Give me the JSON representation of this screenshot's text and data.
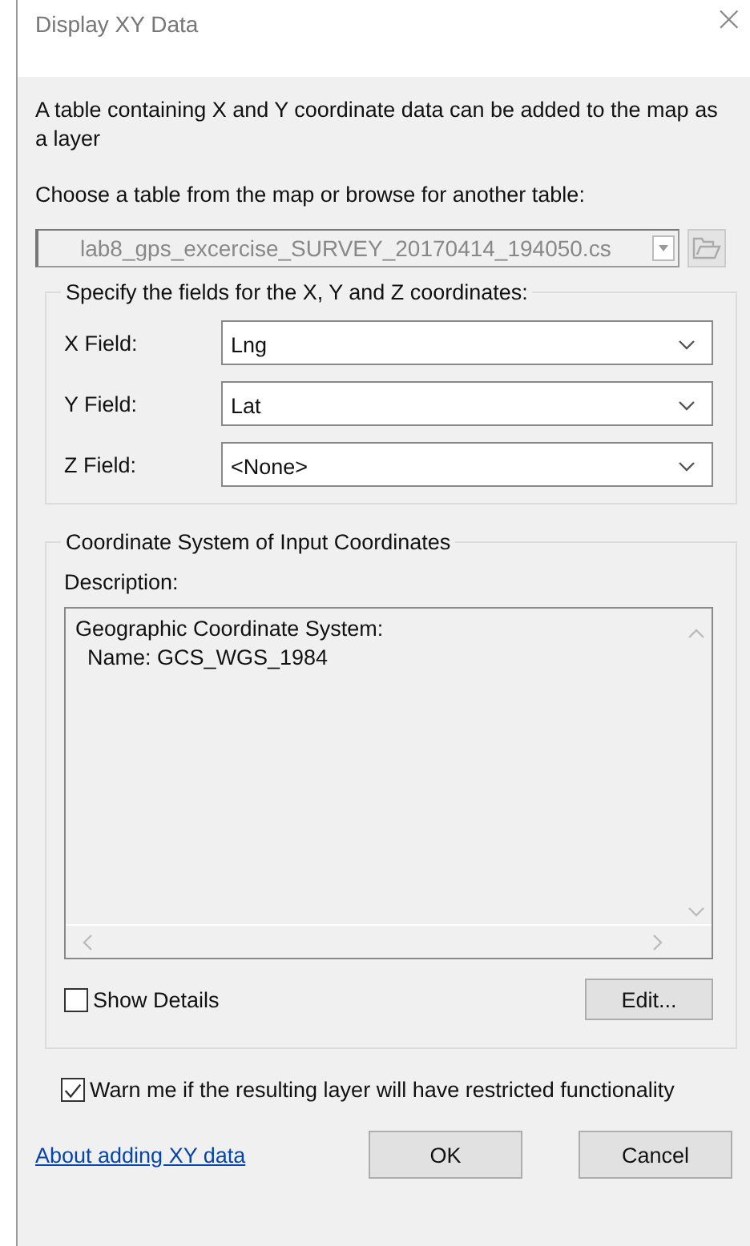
{
  "window": {
    "title": "Display XY Data",
    "close": "×"
  },
  "intro": "A table containing X and Y coordinate data can be added to the map as a layer",
  "table_prompt": "Choose a table from the map or browse for another table:",
  "table_combo": {
    "value": "lab8_gps_excercise_SURVEY_20170414_194050.cs",
    "disabled": true
  },
  "fields_group": {
    "title": "Specify the fields for the X, Y and Z coordinates:",
    "fields": [
      {
        "label": "X Field:",
        "value": "Lng"
      },
      {
        "label": "Y Field:",
        "value": "Lat"
      },
      {
        "label": "Z Field:",
        "value": "<None>"
      }
    ]
  },
  "coord_group": {
    "title": "Coordinate System of Input Coordinates",
    "description_label": "Description:",
    "description_lines": [
      "Geographic Coordinate System:",
      "  Name: GCS_WGS_1984"
    ],
    "show_details": {
      "label": "Show Details",
      "checked": false
    },
    "edit_button": "Edit..."
  },
  "warn": {
    "label": "Warn me if the resulting layer will have restricted functionality",
    "checked": true
  },
  "help_link": "About adding XY data",
  "buttons": [
    {
      "label": "OK"
    },
    {
      "label": "Cancel"
    }
  ]
}
